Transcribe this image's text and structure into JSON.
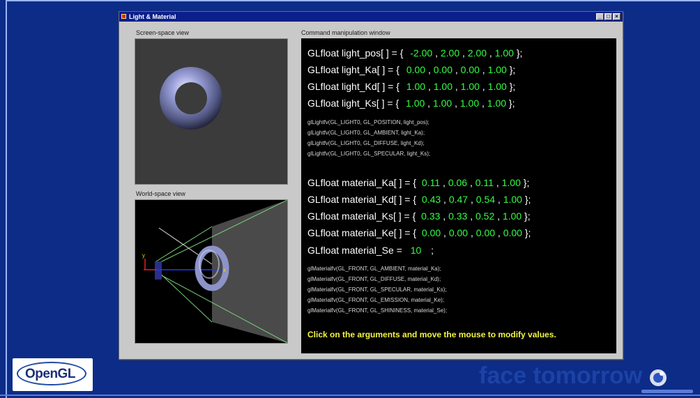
{
  "window": {
    "title": "Light & Material",
    "controls": {
      "minimize": "_",
      "maximize": "□",
      "close": "×"
    }
  },
  "panels": {
    "screen_label": "Screen-space view",
    "world_label": "World-space view",
    "command_label": "Command manipulation window"
  },
  "world_axes": {
    "y": "y",
    "x": "x"
  },
  "light": [
    {
      "prefix": "GLfloat light_pos[ ] = {",
      "values": [
        "-2.00",
        "2.00",
        "2.00",
        "1.00"
      ]
    },
    {
      "prefix": "GLfloat light_Ka[ ] = {",
      "values": [
        "0.00",
        "0.00",
        "0.00",
        "1.00"
      ]
    },
    {
      "prefix": "GLfloat light_Kd[ ] = {",
      "values": [
        "1.00",
        "1.00",
        "1.00",
        "1.00"
      ]
    },
    {
      "prefix": "GLfloat light_Ks[ ] = {",
      "values": [
        "1.00",
        "1.00",
        "1.00",
        "1.00"
      ]
    }
  ],
  "light_calls": [
    "glLightfv(GL_LIGHT0, GL_POSITION, light_pos);",
    "glLightfv(GL_LIGHT0, GL_AMBIENT, light_Ka);",
    "glLightfv(GL_LIGHT0, GL_DIFFUSE, light_Kd);",
    "glLightfv(GL_LIGHT0, GL_SPECULAR, light_Ks);"
  ],
  "material": [
    {
      "prefix": "GLfloat material_Ka[ ] = {",
      "values": [
        "0.11",
        "0.06",
        "0.11",
        "1.00"
      ]
    },
    {
      "prefix": "GLfloat material_Kd[ ] = {",
      "values": [
        "0.43",
        "0.47",
        "0.54",
        "1.00"
      ]
    },
    {
      "prefix": "GLfloat material_Ks[ ] = {",
      "values": [
        "0.33",
        "0.33",
        "0.52",
        "1.00"
      ]
    },
    {
      "prefix": "GLfloat material_Ke[ ] = {",
      "values": [
        "0.00",
        "0.00",
        "0.00",
        "0.00"
      ]
    }
  ],
  "material_se": {
    "prefix": "GLfloat material_Se =",
    "value": "10",
    "suffix": ";"
  },
  "material_calls": [
    "glMaterialfv(GL_FRONT, GL_AMBIENT, material_Ka);",
    "glMaterialfv(GL_FRONT, GL_DIFFUSE, material_Kd);",
    "glMaterialfv(GL_FRONT, GL_SPECULAR, material_Ks);",
    "glMaterialfv(GL_FRONT, GL_EMISSION, material_Ke);",
    "glMaterialfv(GL_FRONT, GL_SHININESS, material_Se);"
  ],
  "hint": "Click on the arguments and move the mouse to modify values.",
  "branding": {
    "logo_text": "OpenGL",
    "watermark": "face tomorrow"
  },
  "colors": {
    "background": "#0c2c87",
    "titlebar": "#0b1f8a",
    "value_green": "#33ff44",
    "hint_yellow": "#f5f542",
    "torus": "#8c93c8"
  }
}
